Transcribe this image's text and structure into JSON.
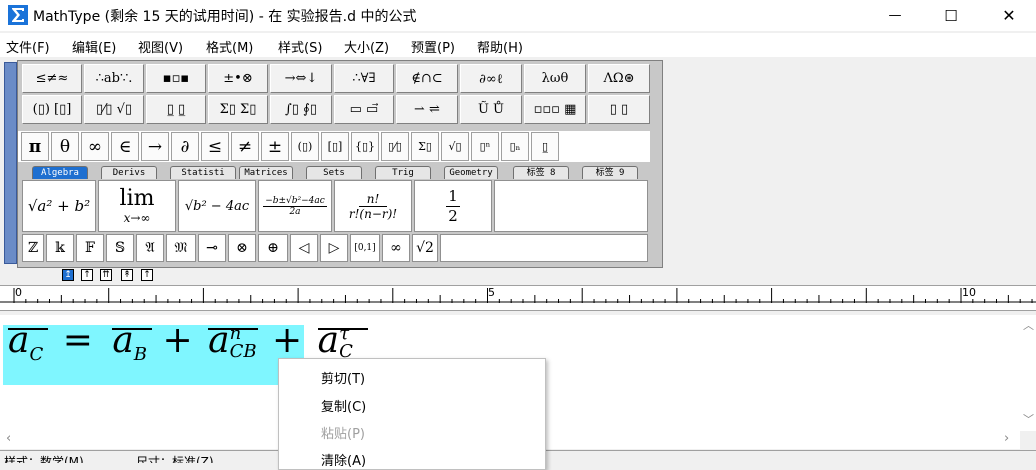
{
  "window": {
    "title": "MathType (剩余 15 天的试用时间) - 在 实验报告.d 中的公式",
    "minimize": "—",
    "maximize": "☐",
    "close": "✕"
  },
  "menu": [
    "文件(F)",
    "编辑(E)",
    "视图(V)",
    "格式(M)",
    "样式(S)",
    "大小(Z)",
    "预置(P)",
    "帮助(H)"
  ],
  "symbol_row1": [
    "≤≠≈",
    "∴ab∵.",
    "▪︎▫︎▪︎",
    "±•⊗",
    "→⇔↓",
    "∴∀∃",
    "∉∩⊂",
    "∂∞ℓ",
    "λωθ",
    "ΛΩ⊛"
  ],
  "symbol_row2": [
    "(▯) [▯]",
    "▯⁄▯ √▯",
    "▯̲ ▯̲",
    "Σ▯ Σ▯",
    "∫▯ ∮▯",
    "▭ ▭⃗",
    "⇀ ⇌",
    "Ũ Ů",
    "▫▫▫ ▦",
    "▯ ▯"
  ],
  "small_symbols": [
    "π",
    "θ",
    "∞",
    "∈",
    "→",
    "∂",
    "≤",
    "≠",
    "±",
    "(▯)",
    "[▯]",
    "{▯}",
    "▯⁄▯",
    "Σ▯",
    "√▯",
    "▯ⁿ",
    "▯ₙ",
    "▯̲"
  ],
  "tabs": [
    "Algebra",
    "Derivs",
    "Statisti",
    "Matrices",
    "Sets",
    "Trig",
    "Geometry",
    "标签 8",
    "标签 9"
  ],
  "templates": {
    "t1": "√a² + b²",
    "t2_top": "lim",
    "t2_bottom": "x→∞",
    "t3": "√b² − 4ac",
    "t4_top": "−b±√b²−4ac",
    "t4_bottom": "2a",
    "t5_top": "n!",
    "t5_bottom": "r!(n−r)!",
    "t6_top": "1",
    "t6_bottom": "2"
  },
  "bottom_row": [
    "ℤ",
    "𝕜",
    "𝔽",
    "𝕊",
    "𝔄",
    "𝔐",
    "⊸",
    "⊗",
    "⊕",
    "◁",
    "▷",
    "[0,1]",
    "∞",
    "√2"
  ],
  "ruler": [
    "0",
    "5",
    "10"
  ],
  "equation": {
    "a": "a",
    "C": "C",
    "eq": "=",
    "aB": "a",
    "B": "B",
    "plus": "+",
    "an": "a",
    "n": "n",
    "CB": "CB",
    "plus2": "+",
    "at": "a",
    "tau": "τ",
    "C2": "C"
  },
  "status": [
    "样式：数学(M)",
    "尺寸：标准(Z)"
  ],
  "context_menu": [
    {
      "label": "剪切(T)",
      "enabled": true
    },
    {
      "label": "复制(C)",
      "enabled": true
    },
    {
      "label": "粘贴(P)",
      "enabled": false
    },
    {
      "label": "清除(A)",
      "enabled": true
    }
  ],
  "colors": {
    "highlight": "#7ff6ff",
    "accent": "#1e6fd0"
  }
}
